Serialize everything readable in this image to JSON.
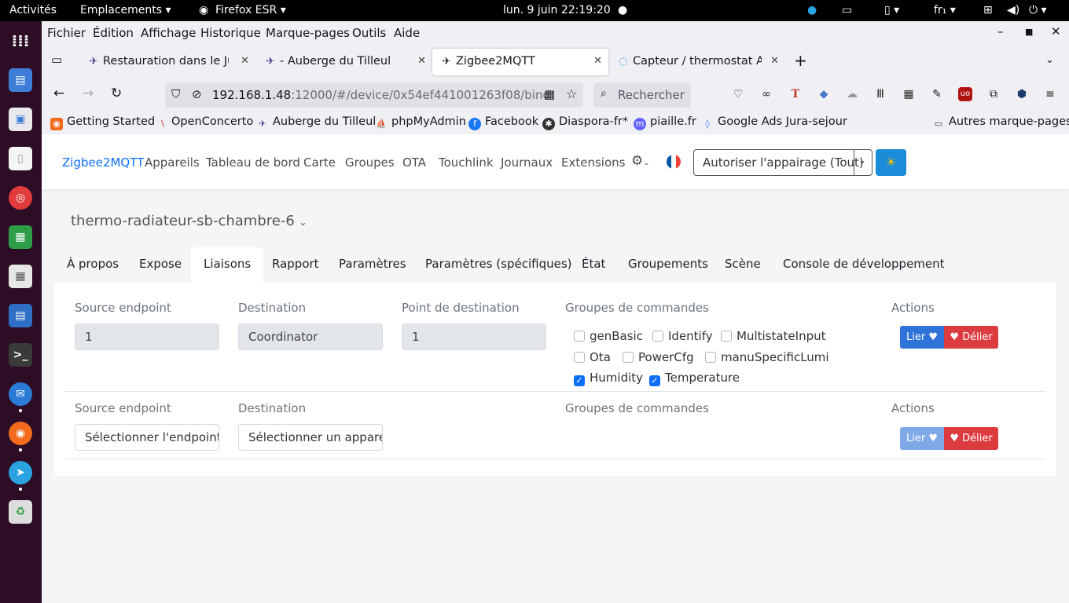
{
  "topbar": {
    "activities": "Activités",
    "places": "Emplacements ▾",
    "app": "Firefox ESR ▾",
    "clock": "lun. 9 juin  22:19:20",
    "lang": "fr₁ ▾"
  },
  "menu": [
    "Fichier",
    "Édition",
    "Affichage",
    "Historique",
    "Marque-pages",
    "Outils",
    "Aide"
  ],
  "tabs": [
    {
      "label": "Restauration dans le Jura",
      "icon": "bird-icon"
    },
    {
      "label": "- Auberge du Tilleul",
      "icon": "bird-icon"
    },
    {
      "label": "Zigbee2MQTT",
      "icon": "bee-icon"
    },
    {
      "label": "Capteur / thermostat Aqara",
      "icon": "circle-icon"
    }
  ],
  "url": {
    "host": "192.168.1.48",
    "rest": ":12000/#/device/0x54ef441001263f08/bind"
  },
  "search_placeholder": "Rechercher",
  "bookmarks": [
    "Getting Started",
    "OpenConcerto",
    "Auberge du Tilleul",
    "phpMyAdmin",
    "Facebook",
    "Diaspora-fr*",
    "piaille.fr",
    "Google Ads Jura-sejour",
    "Autres marque-pages"
  ],
  "appnav": {
    "brand": "Zigbee2MQTT",
    "links": [
      "Appareils",
      "Tableau de bord",
      "Carte",
      "Groupes",
      "OTA",
      "Touchlink",
      "Journaux",
      "Extensions"
    ],
    "permit_join": "Autoriser l'appairage (Tout)"
  },
  "device": {
    "name": "thermo-radiateur-sb-chambre-6"
  },
  "device_tabs": [
    "À propos",
    "Expose",
    "Liaisons",
    "Rapport",
    "Paramètres",
    "Paramètres (spécifiques)",
    "État",
    "Groupements",
    "Scène",
    "Console de développement"
  ],
  "binding_labels": {
    "source_endpoint": "Source endpoint",
    "destination": "Destination",
    "destination_endpoint": "Point de destination",
    "clusters": "Groupes de commandes",
    "actions": "Actions"
  },
  "binding1": {
    "source_endpoint": "1",
    "destination": "Coordinator",
    "destination_endpoint": "1",
    "clusters": [
      {
        "name": "genBasic",
        "checked": false
      },
      {
        "name": "Identify",
        "checked": false
      },
      {
        "name": "MultistateInput",
        "checked": false
      },
      {
        "name": "Ota",
        "checked": false
      },
      {
        "name": "PowerCfg",
        "checked": false
      },
      {
        "name": "manuSpecificLumi",
        "checked": false
      },
      {
        "name": "Humidity",
        "checked": true
      },
      {
        "name": "Temperature",
        "checked": true
      }
    ]
  },
  "binding2": {
    "source_placeholder": "Sélectionner l'endpoint",
    "destination_placeholder": "Sélectionner un appareil"
  },
  "buttons": {
    "bind": "Lier",
    "unbind": "Délier"
  }
}
